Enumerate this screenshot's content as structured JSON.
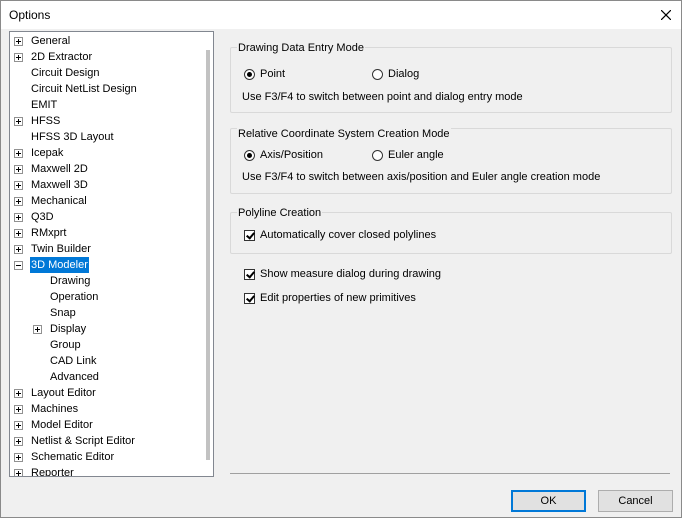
{
  "window": {
    "title": "Options"
  },
  "tree": {
    "items": [
      {
        "label": "General",
        "expander": "plus"
      },
      {
        "label": "2D Extractor",
        "expander": "plus"
      },
      {
        "label": "Circuit Design",
        "expander": "none"
      },
      {
        "label": "Circuit NetList Design",
        "expander": "none"
      },
      {
        "label": "EMIT",
        "expander": "none"
      },
      {
        "label": "HFSS",
        "expander": "plus"
      },
      {
        "label": "HFSS 3D Layout",
        "expander": "none"
      },
      {
        "label": "Icepak",
        "expander": "plus"
      },
      {
        "label": "Maxwell 2D",
        "expander": "plus"
      },
      {
        "label": "Maxwell 3D",
        "expander": "plus"
      },
      {
        "label": "Mechanical",
        "expander": "plus"
      },
      {
        "label": "Q3D",
        "expander": "plus"
      },
      {
        "label": "RMxprt",
        "expander": "plus"
      },
      {
        "label": "Twin Builder",
        "expander": "plus"
      },
      {
        "label": "3D Modeler",
        "expander": "minus",
        "selected": true
      },
      {
        "label": "Drawing",
        "expander": "none",
        "child": true
      },
      {
        "label": "Operation",
        "expander": "none",
        "child": true
      },
      {
        "label": "Snap",
        "expander": "none",
        "child": true
      },
      {
        "label": "Display",
        "expander": "plus",
        "child": true
      },
      {
        "label": "Group",
        "expander": "none",
        "child": true
      },
      {
        "label": "CAD Link",
        "expander": "none",
        "child": true
      },
      {
        "label": "Advanced",
        "expander": "none",
        "child": true
      },
      {
        "label": "Layout Editor",
        "expander": "plus"
      },
      {
        "label": "Machines",
        "expander": "plus"
      },
      {
        "label": "Model Editor",
        "expander": "plus"
      },
      {
        "label": "Netlist & Script Editor",
        "expander": "plus"
      },
      {
        "label": "Schematic Editor",
        "expander": "plus"
      },
      {
        "label": "Reporter",
        "expander": "plus"
      }
    ]
  },
  "drawing_mode": {
    "title": "Drawing Data Entry Mode",
    "option_point": "Point",
    "option_dialog": "Dialog",
    "selected": "Point",
    "hint": "Use F3/F4 to switch between point and dialog entry mode"
  },
  "coord_mode": {
    "title": "Relative Coordinate System Creation Mode",
    "option_axis": "Axis/Position",
    "option_euler": "Euler angle",
    "selected": "Axis/Position",
    "hint": "Use F3/F4 to switch between axis/position and Euler angle creation mode"
  },
  "polyline": {
    "title": "Polyline Creation",
    "auto_cover_label": "Automatically cover closed polylines",
    "auto_cover_checked": true
  },
  "options": {
    "show_measure_label": "Show measure dialog during drawing",
    "show_measure_checked": true,
    "edit_properties_label": "Edit properties of new primitives",
    "edit_properties_checked": true
  },
  "buttons": {
    "ok": "OK",
    "cancel": "Cancel"
  }
}
